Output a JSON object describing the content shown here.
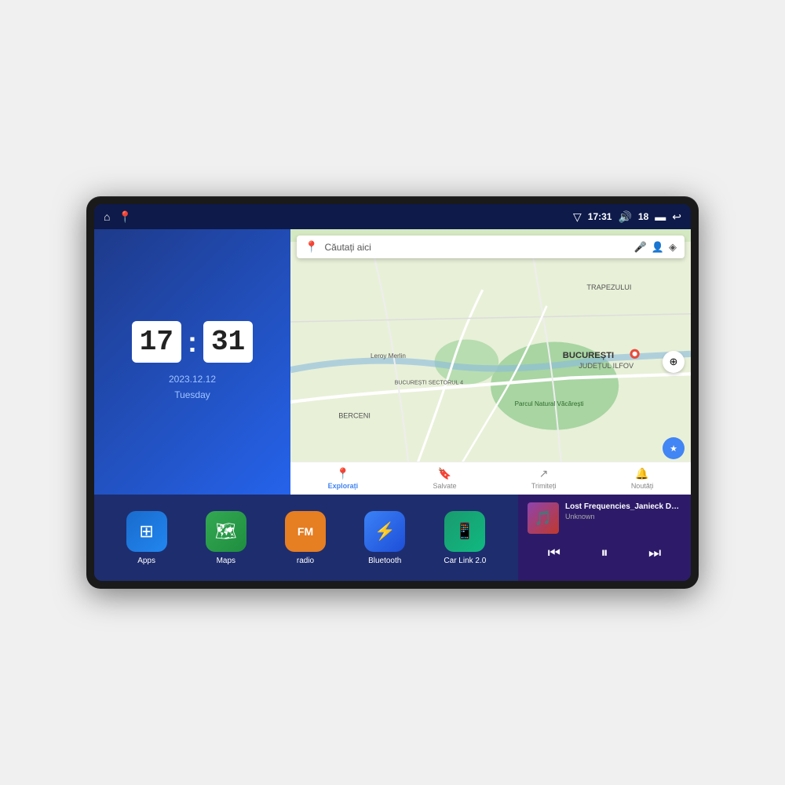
{
  "device": {
    "screen_bg": "#1a2a6c"
  },
  "status_bar": {
    "left_icons": [
      "home-icon",
      "map-pin-icon"
    ],
    "time": "17:31",
    "volume_icon": "volume-icon",
    "battery_level": "18",
    "battery_icon": "battery-icon",
    "back_icon": "back-icon",
    "nav_icon": "nav-icon"
  },
  "clock": {
    "hour": "17",
    "minute": "31",
    "date": "2023.12.12",
    "day": "Tuesday"
  },
  "map": {
    "search_placeholder": "Căutați aici",
    "bottom_items": [
      {
        "label": "Explorați",
        "active": true
      },
      {
        "label": "Salvate",
        "active": false
      },
      {
        "label": "Trimiteți",
        "active": false
      },
      {
        "label": "Noutăți",
        "active": false
      }
    ],
    "labels": [
      "BUCUREȘTI",
      "JUDEȚUL ILFOV",
      "TRAPEZULUI",
      "BERCENI",
      "Parcul Natural Văcărești",
      "Leroy Merlin",
      "BUCUREȘTI SECTORUL 4"
    ]
  },
  "apps": [
    {
      "name": "Apps",
      "icon": "grid-icon",
      "color_class": "icon-apps"
    },
    {
      "name": "Maps",
      "icon": "map-icon",
      "color_class": "icon-maps"
    },
    {
      "name": "radio",
      "icon": "radio-icon",
      "color_class": "icon-radio"
    },
    {
      "name": "Bluetooth",
      "icon": "bluetooth-icon",
      "color_class": "icon-bluetooth"
    },
    {
      "name": "Car Link 2.0",
      "icon": "link-icon",
      "color_class": "icon-carlink"
    }
  ],
  "music": {
    "title": "Lost Frequencies_Janieck Devy-...",
    "artist": "Unknown",
    "prev_label": "⏮",
    "play_label": "⏸",
    "next_label": "⏭"
  }
}
